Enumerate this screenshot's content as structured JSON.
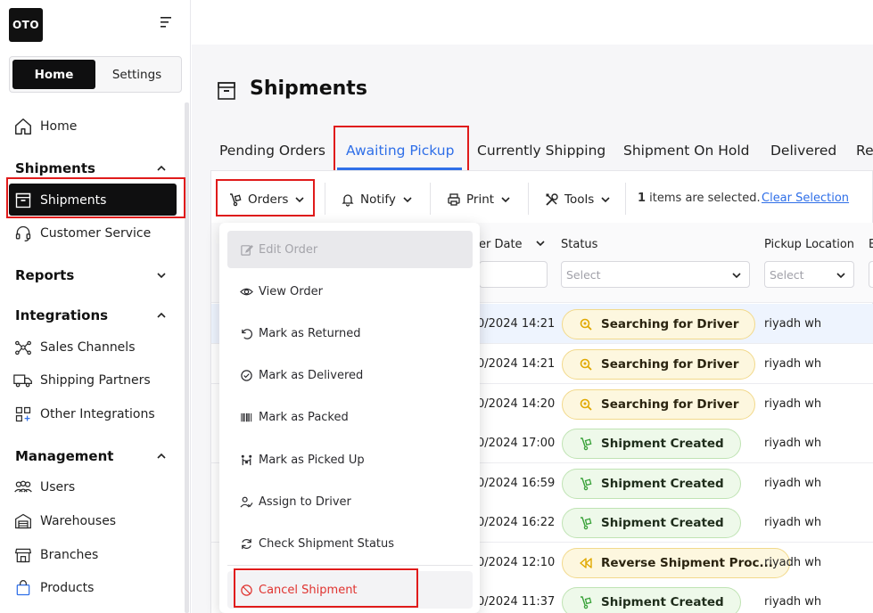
{
  "app": {
    "logo_text": "OTO"
  },
  "sidebar": {
    "segment": {
      "home": "Home",
      "settings": "Settings"
    },
    "home_item": "Home",
    "sections": {
      "shipments": "Shipments",
      "reports": "Reports",
      "integrations": "Integrations",
      "management": "Management"
    },
    "items": {
      "shipments": "Shipments",
      "customer_service": "Customer Service",
      "sales_channels": "Sales Channels",
      "shipping_partners": "Shipping Partners",
      "other_integrations": "Other Integrations",
      "users": "Users",
      "warehouses": "Warehouses",
      "branches": "Branches",
      "products": "Products"
    }
  },
  "page": {
    "title": "Shipments"
  },
  "tabs": [
    "Pending Orders",
    "Awaiting Pickup",
    "Currently Shipping",
    "Shipment On Hold",
    "Delivered",
    "Re"
  ],
  "toolbar": {
    "orders": "Orders",
    "notify": "Notify",
    "print": "Print",
    "tools": "Tools",
    "selected_count": "1",
    "selected_suffix": " items are selected.",
    "clear": "Clear Selection"
  },
  "table": {
    "headers": {
      "date": "er Date",
      "status": "Status",
      "pickup": "Pickup Location",
      "next": "E"
    },
    "filters": {
      "status_placeholder": "Select",
      "pickup_placeholder": "Select"
    },
    "rows": [
      {
        "date": "0/2024 14:21",
        "status": "Searching for Driver",
        "status_type": "searching",
        "location": "riyadh wh"
      },
      {
        "date": "0/2024 14:21",
        "status": "Searching for Driver",
        "status_type": "searching",
        "location": "riyadh wh"
      },
      {
        "date": "0/2024 14:20",
        "status": "Searching for Driver",
        "status_type": "searching",
        "location": "riyadh wh"
      },
      {
        "date": "0/2024 17:00",
        "status": "Shipment Created",
        "status_type": "created",
        "location": "riyadh wh"
      },
      {
        "date": "0/2024 16:59",
        "status": "Shipment Created",
        "status_type": "created",
        "location": "riyadh wh"
      },
      {
        "date": "0/2024 16:22",
        "status": "Shipment Created",
        "status_type": "created",
        "location": "riyadh wh"
      },
      {
        "date": "0/2024 12:10",
        "status": "Reverse Shipment Proc...",
        "status_type": "reverse",
        "location": "riyadh wh"
      },
      {
        "date": "0/2024 11:37",
        "status": "Shipment Created",
        "status_type": "created",
        "location": "riyadh wh"
      }
    ]
  },
  "orders_menu": {
    "edit": "Edit Order",
    "view": "View Order",
    "returned": "Mark as Returned",
    "delivered": "Mark as Delivered",
    "packed": "Mark as Packed",
    "picked_up": "Mark as Picked Up",
    "assign": "Assign to Driver",
    "check": "Check Shipment Status",
    "cancel": "Cancel Shipment"
  },
  "colors": {
    "accent": "#2f6fe8",
    "highlight_box": "#e01b1b",
    "danger": "#e0332f"
  }
}
